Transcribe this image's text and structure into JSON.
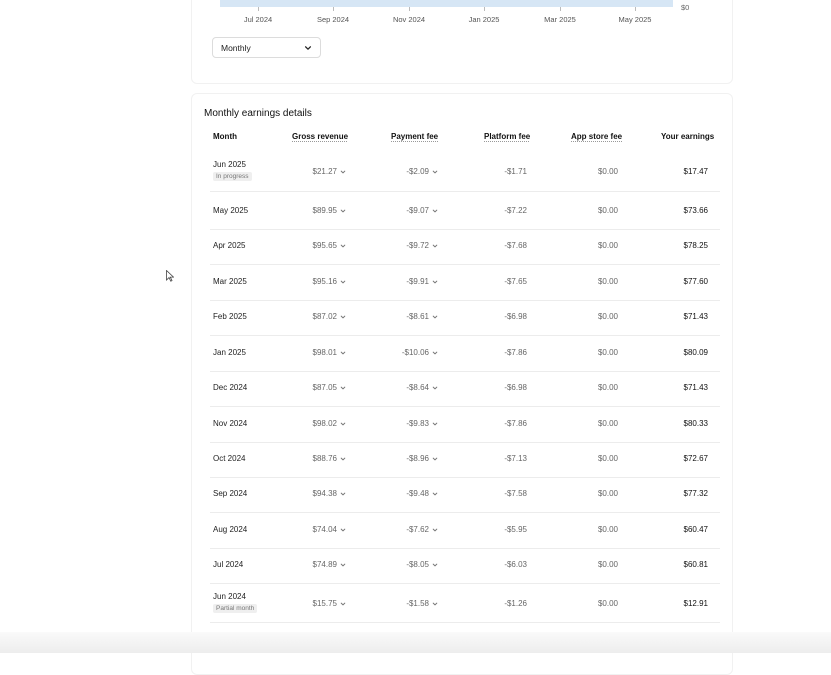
{
  "chart": {
    "x_ticks": [
      "Jul 2024",
      "Sep 2024",
      "Nov 2024",
      "Jan 2025",
      "Mar 2025",
      "May 2025"
    ],
    "y_tick": "$0",
    "band_color": "#d6e6f5"
  },
  "period_select": {
    "value": "Monthly",
    "icon": "chevron-down-icon"
  },
  "earnings_table": {
    "title": "Monthly earnings details",
    "columns": {
      "month": "Month",
      "gross": "Gross revenue",
      "payment": "Payment fee",
      "platform": "Platform fee",
      "appstore": "App store fee",
      "earnings": "Your earnings"
    },
    "rows": [
      {
        "month": "Jun 2025",
        "badge": "In progress",
        "gross": "$21.27",
        "payment": "-$2.09",
        "platform": "-$1.71",
        "appstore": "$0.00",
        "earnings": "$17.47"
      },
      {
        "month": "May 2025",
        "badge": "",
        "gross": "$89.95",
        "payment": "-$9.07",
        "platform": "-$7.22",
        "appstore": "$0.00",
        "earnings": "$73.66"
      },
      {
        "month": "Apr 2025",
        "badge": "",
        "gross": "$95.65",
        "payment": "-$9.72",
        "platform": "-$7.68",
        "appstore": "$0.00",
        "earnings": "$78.25"
      },
      {
        "month": "Mar 2025",
        "badge": "",
        "gross": "$95.16",
        "payment": "-$9.91",
        "platform": "-$7.65",
        "appstore": "$0.00",
        "earnings": "$77.60"
      },
      {
        "month": "Feb 2025",
        "badge": "",
        "gross": "$87.02",
        "payment": "-$8.61",
        "platform": "-$6.98",
        "appstore": "$0.00",
        "earnings": "$71.43"
      },
      {
        "month": "Jan 2025",
        "badge": "",
        "gross": "$98.01",
        "payment": "-$10.06",
        "platform": "-$7.86",
        "appstore": "$0.00",
        "earnings": "$80.09"
      },
      {
        "month": "Dec 2024",
        "badge": "",
        "gross": "$87.05",
        "payment": "-$8.64",
        "platform": "-$6.98",
        "appstore": "$0.00",
        "earnings": "$71.43"
      },
      {
        "month": "Nov 2024",
        "badge": "",
        "gross": "$98.02",
        "payment": "-$9.83",
        "platform": "-$7.86",
        "appstore": "$0.00",
        "earnings": "$80.33"
      },
      {
        "month": "Oct 2024",
        "badge": "",
        "gross": "$88.76",
        "payment": "-$8.96",
        "platform": "-$7.13",
        "appstore": "$0.00",
        "earnings": "$72.67"
      },
      {
        "month": "Sep 2024",
        "badge": "",
        "gross": "$94.38",
        "payment": "-$9.48",
        "platform": "-$7.58",
        "appstore": "$0.00",
        "earnings": "$77.32"
      },
      {
        "month": "Aug 2024",
        "badge": "",
        "gross": "$74.04",
        "payment": "-$7.62",
        "platform": "-$5.95",
        "appstore": "$0.00",
        "earnings": "$60.47"
      },
      {
        "month": "Jul 2024",
        "badge": "",
        "gross": "$74.89",
        "payment": "-$8.05",
        "platform": "-$6.03",
        "appstore": "$0.00",
        "earnings": "$60.81"
      },
      {
        "month": "Jun 2024",
        "badge": "Partial month",
        "gross": "$15.75",
        "payment": "-$1.58",
        "platform": "-$1.26",
        "appstore": "$0.00",
        "earnings": "$12.91"
      }
    ]
  }
}
